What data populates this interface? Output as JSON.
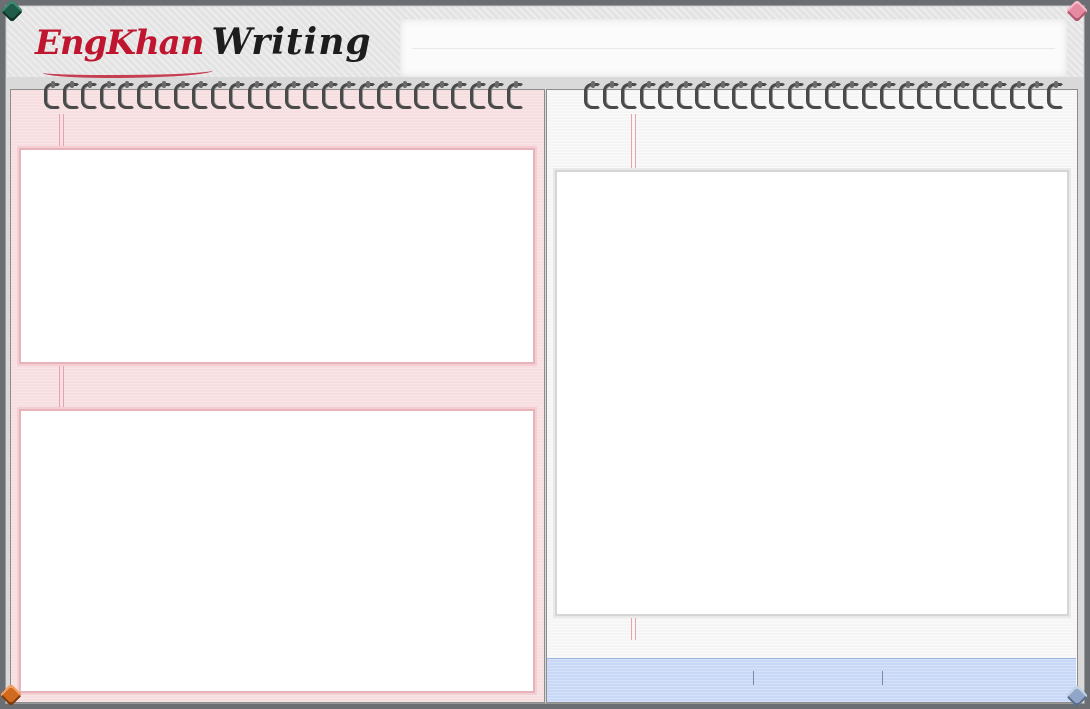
{
  "header": {
    "logo_part1": "EngKhan",
    "logo_part2": "Writing"
  },
  "left_notebook": {
    "ring_count": 26,
    "top_textarea": {
      "value": ""
    },
    "bottom_textarea": {
      "value": ""
    }
  },
  "right_notebook": {
    "ring_count": 26,
    "main_textarea": {
      "value": ""
    }
  },
  "status_bar": {
    "segment_1": "",
    "segment_2": "",
    "segment_3": ""
  },
  "colors": {
    "left_paper": "#f7dfe1",
    "right_paper": "#f5f5f5",
    "status_bar": "#c8d8f6",
    "logo_red": "#c0152f"
  },
  "icons": [
    "corner-pin-icon",
    "spiral-ring-icon"
  ]
}
